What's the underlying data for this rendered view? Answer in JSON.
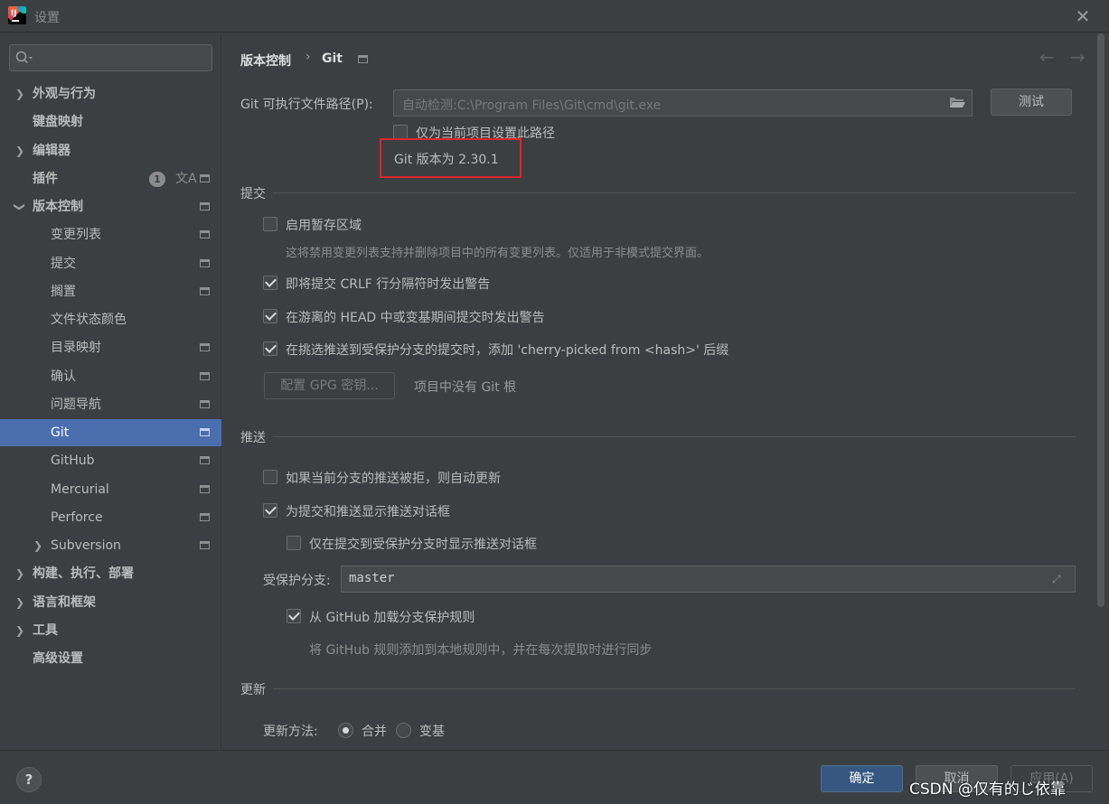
{
  "window": {
    "title": "设置"
  },
  "search": {
    "placeholder": ""
  },
  "sidebar": {
    "items": [
      {
        "label": "外观与行为"
      },
      {
        "label": "键盘映射"
      },
      {
        "label": "编辑器"
      },
      {
        "label": "插件",
        "badge": "1"
      },
      {
        "label": "版本控制"
      },
      {
        "label": "变更列表"
      },
      {
        "label": "提交"
      },
      {
        "label": "搁置"
      },
      {
        "label": "文件状态颜色"
      },
      {
        "label": "目录映射"
      },
      {
        "label": "确认"
      },
      {
        "label": "问题导航"
      },
      {
        "label": "Git"
      },
      {
        "label": "GitHub"
      },
      {
        "label": "Mercurial"
      },
      {
        "label": "Perforce"
      },
      {
        "label": "Subversion"
      },
      {
        "label": "构建、执行、部署"
      },
      {
        "label": "语言和框架"
      },
      {
        "label": "工具"
      },
      {
        "label": "高级设置"
      }
    ]
  },
  "breadcrumb": {
    "parent": "版本控制",
    "separator": "›",
    "current": "Git"
  },
  "git_path": {
    "label": "Git 可执行文件路径(P):",
    "placeholder": "自动检测:C:\\Program Files\\Git\\cmd\\git.exe",
    "test_button": "测试",
    "project_only_label": "仅为当前项目设置此路径",
    "version_text": "Git 版本为 2.30.1"
  },
  "commit": {
    "title": "提交",
    "staging_label": "启用暂存区域",
    "staging_hint": "这将禁用变更列表支持并删除项目中的所有变更列表。仅适用于非模式提交界面。",
    "crlf_label": "即将提交 CRLF 行分隔符时发出警告",
    "detached_label": "在游离的 HEAD 中或变基期间提交时发出警告",
    "cherry_label": "在挑选推送到受保护分支的提交时，添加 'cherry-picked from <hash>' 后缀",
    "gpg_button": "配置 GPG 密钥...",
    "gpg_hint": "项目中没有 Git 根"
  },
  "push": {
    "title": "推送",
    "auto_update_label": "如果当前分支的推送被拒，则自动更新",
    "show_dialog_label": "为提交和推送显示推送对话框",
    "protected_only_label": "仅在提交到受保护分支时显示推送对话框",
    "protected_branches_label": "受保护分支:",
    "protected_branches_value": "master",
    "github_rules_label": "从 GitHub 加载分支保护规则",
    "github_rules_hint": "将 GitHub 规则添加到本地规则中，并在每次提取时进行同步"
  },
  "update": {
    "title": "更新",
    "method_label": "更新方法:",
    "merge_label": "合并",
    "rebase_label": "变基"
  },
  "footer": {
    "help": "?",
    "ok": "确定",
    "cancel": "取消",
    "apply": "应用(A)",
    "watermark": "CSDN @仅有的じ依靠"
  }
}
